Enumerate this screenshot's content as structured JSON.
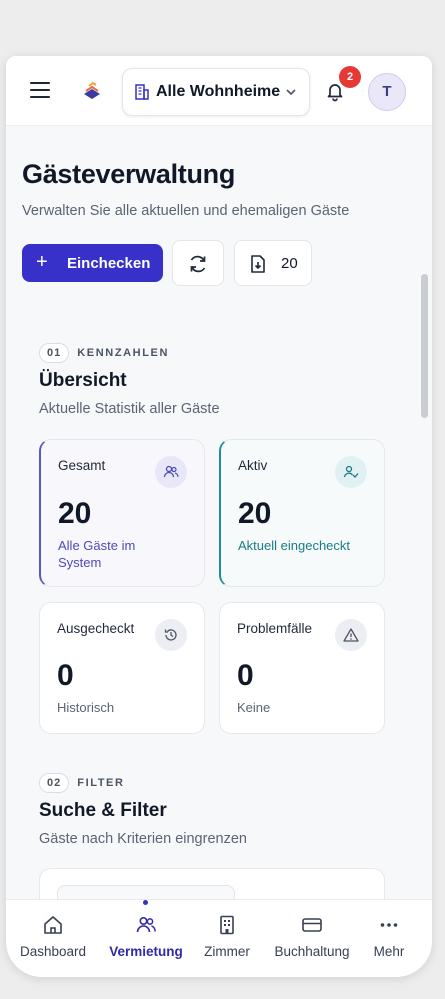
{
  "header": {
    "property_select": "Alle Wohnheime",
    "notification_count": "2",
    "avatar_initial": "T"
  },
  "page": {
    "title": "Gästeverwaltung",
    "subtitle": "Verwalten Sie alle aktuellen und ehemaligen Gäste",
    "checkin_button": "Einchecken",
    "plus_symbol": "+",
    "export_count": "20"
  },
  "overview": {
    "number": "01",
    "tag": "KENNZAHLEN",
    "title": "Übersicht",
    "subtitle": "Aktuelle Statistik aller Gäste",
    "cards": [
      {
        "label": "Gesamt",
        "value": "20",
        "note": "Alle Gäste im System",
        "icon": "users-icon"
      },
      {
        "label": "Aktiv",
        "value": "20",
        "note": "Aktuell eingecheckt",
        "icon": "user-check-icon"
      },
      {
        "label": "Ausgecheckt",
        "value": "0",
        "note": "Historisch",
        "icon": "history-icon"
      },
      {
        "label": "Problemfälle",
        "value": "0",
        "note": "Keine",
        "icon": "warning-icon"
      }
    ]
  },
  "filter": {
    "number": "02",
    "tag": "FILTER",
    "title": "Suche & Filter",
    "subtitle": "Gäste nach Kriterien eingrenzen"
  },
  "bottom_nav": {
    "items": [
      {
        "label": "Dashboard",
        "icon": "home-icon"
      },
      {
        "label": "Vermietung",
        "icon": "users-icon",
        "active": true
      },
      {
        "label": "Zimmer",
        "icon": "building-icon"
      },
      {
        "label": "Buchhaltung",
        "icon": "card-icon"
      },
      {
        "label": "Mehr",
        "icon": "more-icon"
      }
    ]
  },
  "colors": {
    "primary": "#3730c9",
    "badge": "#e53935",
    "teal": "#1b8f95"
  }
}
